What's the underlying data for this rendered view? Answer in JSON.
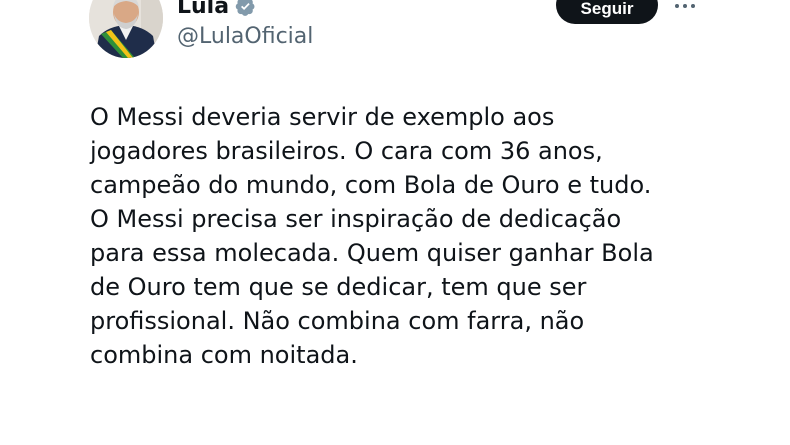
{
  "author": {
    "name": "Lula",
    "handle": "@LulaOficial",
    "verified_icon": "verified-badge-icon",
    "avatar_icon": "profile-photo"
  },
  "actions": {
    "follow_label": "Seguir",
    "more_icon": "more-horizontal-icon"
  },
  "tweet": {
    "lines": [
      "O Messi deveria servir de exemplo aos",
      "jogadores brasileiros. O cara com 36 anos,",
      "campeão do mundo, com Bola de Ouro e tudo.",
      "O Messi precisa ser inspiração de dedicação",
      "para essa molecada. Quem quiser ganhar Bola",
      "de Ouro tem que se dedicar, tem que ser",
      "profissional. Não combina com farra, não",
      "combina com noitada."
    ]
  },
  "colors": {
    "text": "#0f1419",
    "secondary_text": "#536471",
    "follow_button_bg": "#0f1419",
    "verified_badge": "#829aab"
  }
}
